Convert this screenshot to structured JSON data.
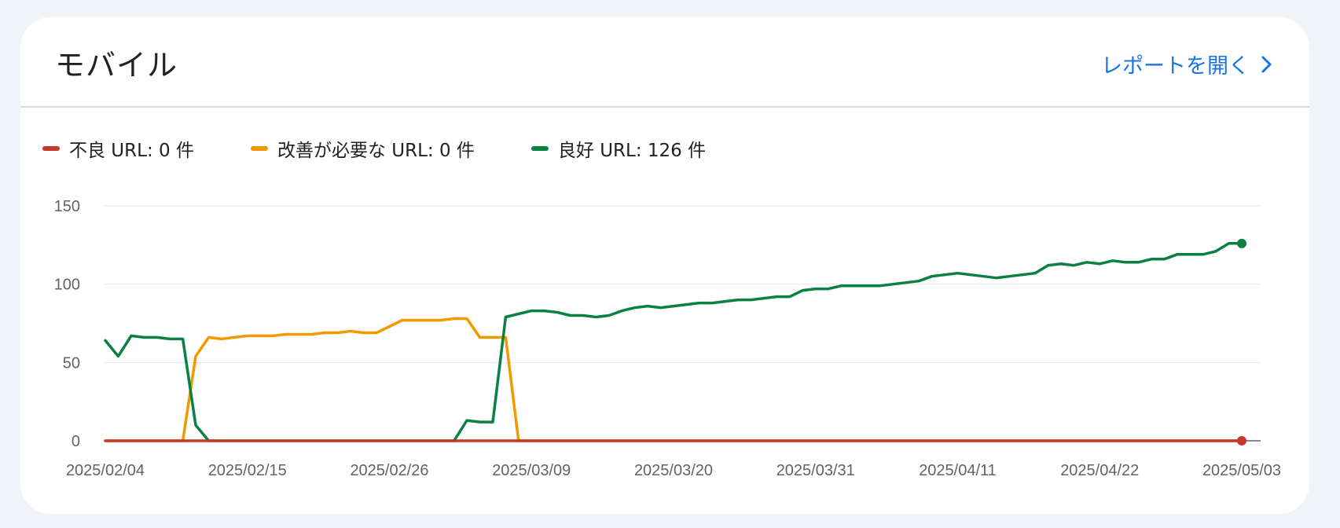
{
  "card": {
    "title": "モバイル",
    "report_link": "レポートを開く",
    "report_link_icon": "chevron-right-icon"
  },
  "legend": [
    {
      "label": "不良 URL: 0 件",
      "color": "#c5392a"
    },
    {
      "label": "改善が必要な URL: 0 件",
      "color": "#f29900"
    },
    {
      "label": "良好 URL: 126 件",
      "color": "#0b8043"
    }
  ],
  "chart_data": {
    "type": "line",
    "title": "",
    "xlabel": "",
    "ylabel": "",
    "ylim": [
      0,
      150
    ],
    "yticks": [
      "0",
      "50",
      "100",
      "150"
    ],
    "x_tick_labels": [
      "2025/02/04",
      "2025/02/15",
      "2025/02/26",
      "2025/03/09",
      "2025/03/20",
      "2025/03/31",
      "2025/04/11",
      "2025/04/22",
      "2025/05/03"
    ],
    "x": [
      "2025/02/04",
      "2025/02/05",
      "2025/02/06",
      "2025/02/07",
      "2025/02/08",
      "2025/02/09",
      "2025/02/10",
      "2025/02/11",
      "2025/02/12",
      "2025/02/13",
      "2025/02/14",
      "2025/02/15",
      "2025/02/16",
      "2025/02/17",
      "2025/02/18",
      "2025/02/19",
      "2025/02/20",
      "2025/02/21",
      "2025/02/22",
      "2025/02/23",
      "2025/02/24",
      "2025/02/25",
      "2025/02/26",
      "2025/02/27",
      "2025/02/28",
      "2025/03/01",
      "2025/03/02",
      "2025/03/03",
      "2025/03/04",
      "2025/03/05",
      "2025/03/06",
      "2025/03/07",
      "2025/03/08",
      "2025/03/09",
      "2025/03/10",
      "2025/03/11",
      "2025/03/12",
      "2025/03/13",
      "2025/03/14",
      "2025/03/15",
      "2025/03/16",
      "2025/03/17",
      "2025/03/18",
      "2025/03/19",
      "2025/03/20",
      "2025/03/21",
      "2025/03/22",
      "2025/03/23",
      "2025/03/24",
      "2025/03/25",
      "2025/03/26",
      "2025/03/27",
      "2025/03/28",
      "2025/03/29",
      "2025/03/30",
      "2025/03/31",
      "2025/04/01",
      "2025/04/02",
      "2025/04/03",
      "2025/04/04",
      "2025/04/05",
      "2025/04/06",
      "2025/04/07",
      "2025/04/08",
      "2025/04/09",
      "2025/04/10",
      "2025/04/11",
      "2025/04/12",
      "2025/04/13",
      "2025/04/14",
      "2025/04/15",
      "2025/04/16",
      "2025/04/17",
      "2025/04/18",
      "2025/04/19",
      "2025/04/20",
      "2025/04/21",
      "2025/04/22",
      "2025/04/23",
      "2025/04/24",
      "2025/04/25",
      "2025/04/26",
      "2025/04/27",
      "2025/04/28",
      "2025/04/29",
      "2025/04/30",
      "2025/05/01",
      "2025/05/02",
      "2025/05/03"
    ],
    "series": [
      {
        "name": "不良 URL",
        "color": "#c5392a",
        "end_marker": true,
        "values": [
          0,
          0,
          0,
          0,
          0,
          0,
          0,
          0,
          0,
          0,
          0,
          0,
          0,
          0,
          0,
          0,
          0,
          0,
          0,
          0,
          0,
          0,
          0,
          0,
          0,
          0,
          0,
          0,
          0,
          0,
          0,
          0,
          0,
          0,
          0,
          0,
          0,
          0,
          0,
          0,
          0,
          0,
          0,
          0,
          0,
          0,
          0,
          0,
          0,
          0,
          0,
          0,
          0,
          0,
          0,
          0,
          0,
          0,
          0,
          0,
          0,
          0,
          0,
          0,
          0,
          0,
          0,
          0,
          0,
          0,
          0,
          0,
          0,
          0,
          0,
          0,
          0,
          0,
          0,
          0,
          0,
          0,
          0,
          0,
          0,
          0,
          0,
          0,
          0
        ]
      },
      {
        "name": "改善が必要な URL",
        "color": "#f29900",
        "end_marker": false,
        "values": [
          0,
          0,
          0,
          0,
          0,
          0,
          0,
          54,
          66,
          65,
          66,
          67,
          67,
          67,
          68,
          68,
          68,
          69,
          69,
          70,
          69,
          69,
          73,
          77,
          77,
          77,
          77,
          78,
          78,
          66,
          66,
          66,
          0,
          0,
          0,
          0,
          0,
          0,
          0,
          0,
          0,
          0,
          0,
          0,
          0,
          0,
          0,
          0,
          0,
          0,
          0,
          0,
          0,
          0,
          0,
          0,
          0,
          0,
          0,
          0,
          0,
          0,
          0,
          0,
          0,
          0,
          0,
          0,
          0,
          0,
          0,
          0,
          0,
          0,
          0,
          0,
          0,
          0,
          0,
          0,
          0,
          0,
          0,
          0,
          0,
          0,
          0,
          0,
          0
        ]
      },
      {
        "name": "良好 URL",
        "color": "#0b8043",
        "end_marker": true,
        "values": [
          64,
          54,
          67,
          66,
          66,
          65,
          65,
          10,
          0,
          0,
          0,
          0,
          0,
          0,
          0,
          0,
          0,
          0,
          0,
          0,
          0,
          0,
          0,
          0,
          0,
          0,
          0,
          0,
          13,
          12,
          12,
          79,
          81,
          83,
          83,
          82,
          80,
          80,
          79,
          80,
          83,
          85,
          86,
          85,
          86,
          87,
          88,
          88,
          89,
          90,
          90,
          91,
          92,
          92,
          96,
          97,
          97,
          99,
          99,
          99,
          99,
          100,
          101,
          102,
          105,
          106,
          107,
          106,
          105,
          104,
          105,
          106,
          107,
          112,
          113,
          112,
          114,
          113,
          115,
          114,
          114,
          116,
          116,
          119,
          119,
          119,
          121,
          126,
          126
        ]
      }
    ]
  }
}
